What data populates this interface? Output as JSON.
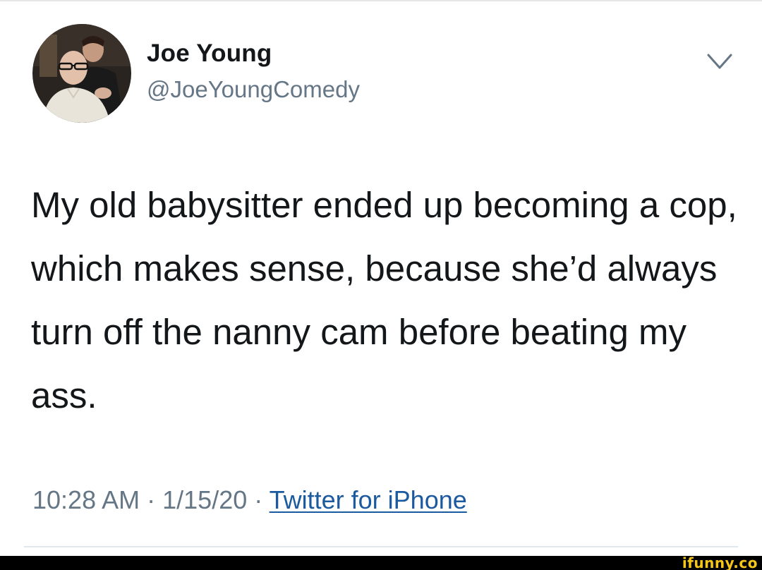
{
  "user": {
    "display_name": "Joe Young",
    "handle": "@JoeYoungComedy"
  },
  "tweet": {
    "text": "My old babysitter ended up becoming a cop, which makes sense, because she’d always turn off the nanny cam before beating my ass."
  },
  "meta": {
    "time": "10:28 AM",
    "separator": "·",
    "date": "1/15/20",
    "source": "Twitter for iPhone"
  },
  "icons": {
    "menu": "chevron-down-icon"
  },
  "watermark": {
    "text": "ifunny.co",
    "color": "#f5c518"
  },
  "colors": {
    "text_primary": "#14171a",
    "text_secondary": "#657786",
    "link": "#1b5a9e",
    "background": "#ffffff"
  }
}
